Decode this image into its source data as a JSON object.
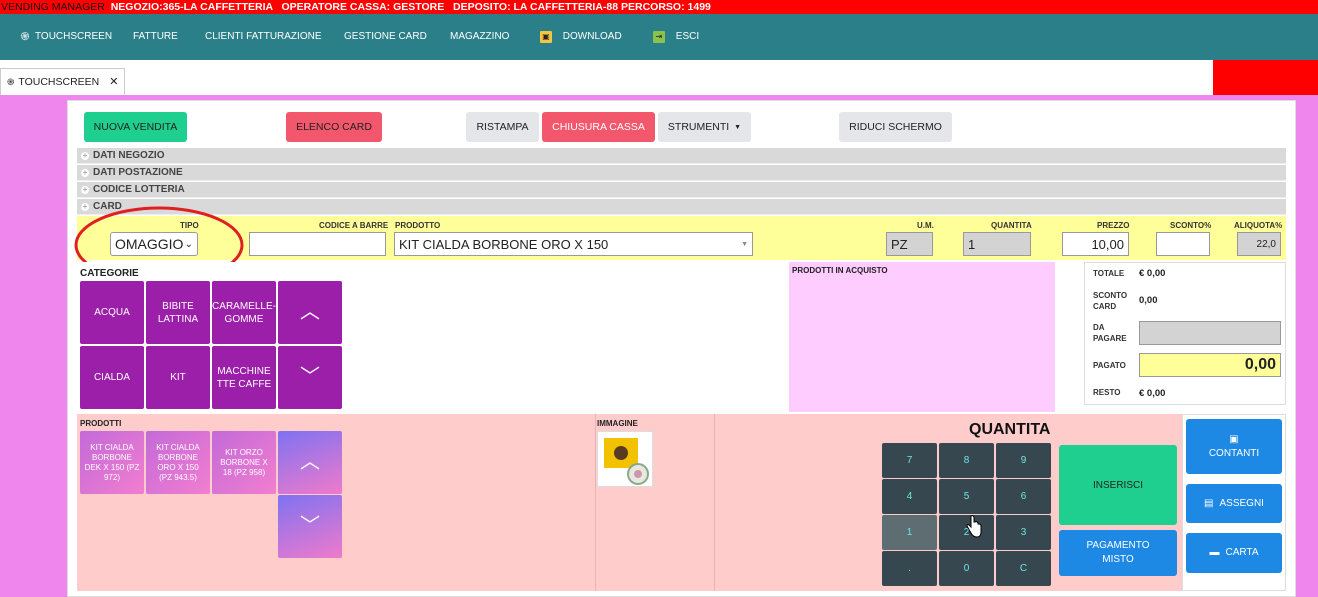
{
  "status": {
    "app": "VENDING MANAGER",
    "negozio": "NEGOZIO:365-LA CAFFETTERIA",
    "operatore": "OPERATORE CASSA: GESTORE",
    "deposito": "DEPOSITO: LA CAFFETTERIA-88 PERCORSO: 1499"
  },
  "nav": {
    "touchscreen": "TOUCHSCREEN",
    "fatture": "FATTURE",
    "clienti": "CLIENTI FATTURAZIONE",
    "card": "GESTIONE CARD",
    "magazzino": "MAGAZZINO",
    "download": "DOWNLOAD",
    "esci": "ESCI"
  },
  "tab": {
    "label": "TOUCHSCREEN",
    "close": "✕"
  },
  "toolbar": {
    "nuova": "NUOVA VENDITA",
    "elenco": "ELENCO CARD",
    "ristampa": "RISTAMPA",
    "chiusura": "CHIUSURA CASSA",
    "strumenti": "STRUMENTI",
    "riduci": "RIDUCI SCHERMO"
  },
  "accordion": [
    "DATI NEGOZIO",
    "DATI POSTAZIONE",
    "CODICE LOTTERIA",
    "CARD"
  ],
  "form": {
    "tipo_label": "TIPO",
    "tipo_value": "OMAGGIO",
    "barcode_label": "CODICE A BARRE",
    "barcode_value": "",
    "prodotto_label": "PRODOTTO",
    "prodotto_value": "KIT CIALDA BORBONE ORO X 150",
    "um_label": "U.M.",
    "um_value": "PZ",
    "qty_label": "QUANTITA",
    "qty_value": "1",
    "prezzo_label": "PREZZO",
    "prezzo_value": "10,00",
    "sconto_label": "SCONTO%",
    "sconto_value": "",
    "aliquota_label": "ALIQUOTA%",
    "aliquota_value": "22,0"
  },
  "categorie": {
    "title": "CATEGORIE",
    "items": [
      "ACQUA",
      "BIBITE LATTINA",
      "CARAMELLE-GOMME",
      "CIALDA",
      "KIT",
      "MACCHINETTE CAFFE"
    ]
  },
  "acquisto": {
    "title": "PRODOTTI IN ACQUISTO"
  },
  "summary": {
    "totale_label": "TOTALE",
    "totale": "€ 0,00",
    "sconto_label": "SCONTO CARD",
    "sconto": "0,00",
    "dapagare_label": "DA PAGARE",
    "dapagare": "",
    "pagato_label": "PAGATO",
    "pagato": "0,00",
    "resto_label": "RESTO",
    "resto": "€ 0,00"
  },
  "prodotti": {
    "title": "PRODOTTI",
    "items": [
      "KIT CIALDA BORBONE DEK X 150 (PZ 972)",
      "KIT CIALDA BORBONE ORO X 150 (PZ 943.5)",
      "KIT ORZO BORBONE X 18 (PZ 958)"
    ]
  },
  "immagine": {
    "title": "IMMAGINE"
  },
  "keypad": {
    "title": "QUANTITA",
    "keys": [
      "7",
      "8",
      "9",
      "4",
      "5",
      "6",
      "1",
      "2",
      "3",
      ".",
      "0",
      "C"
    ]
  },
  "actions": {
    "inserisci": "INSERISCI",
    "misto": "PAGAMENTO MISTO",
    "contanti": "CONTANTI",
    "assegni": "ASSEGNI",
    "carta": "CARTA"
  },
  "colors": {
    "status_bg": "#ff0000",
    "nav_bg": "#2a7f88",
    "page_bg": "#ee86ee",
    "category": "#9b1fa8",
    "green": "#1ecf8f",
    "red": "#f2576b",
    "blue": "#1e88e5",
    "keypad": "#37474f"
  }
}
